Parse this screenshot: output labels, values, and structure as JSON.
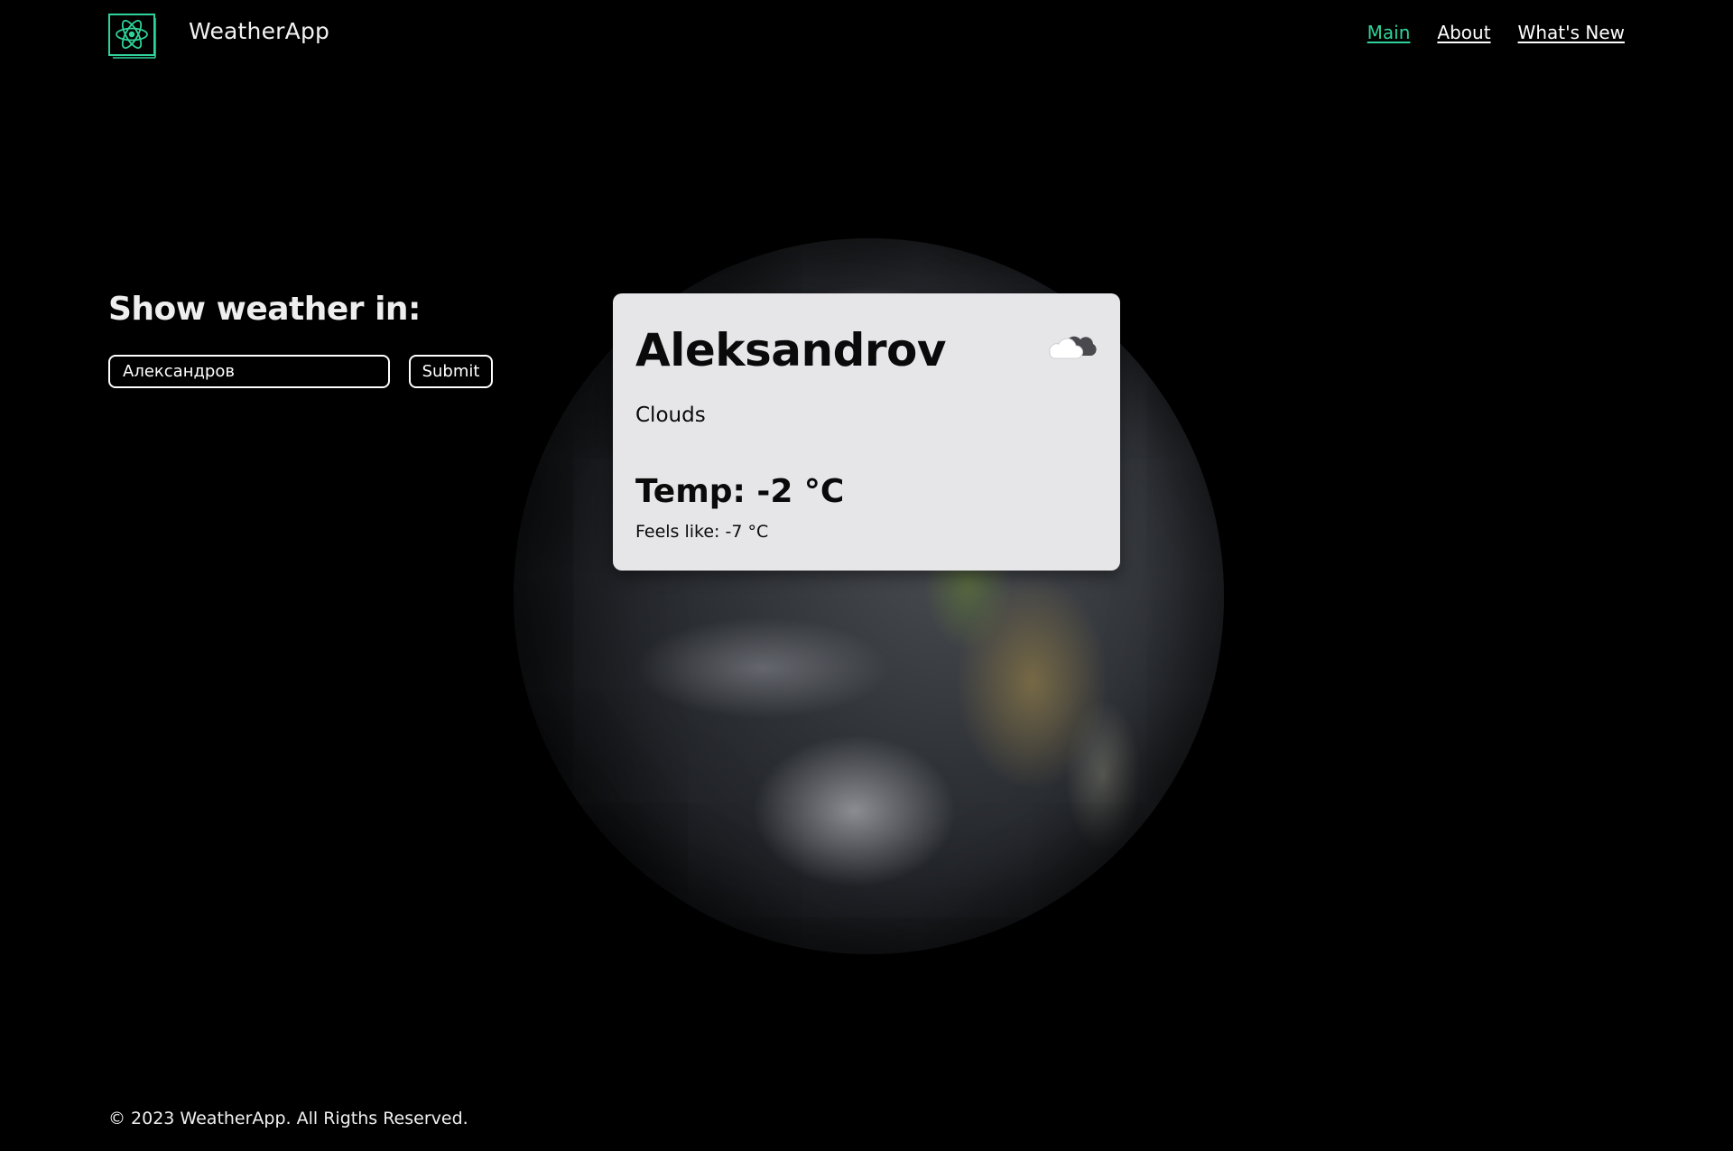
{
  "app": {
    "brand_name": "WeatherApp",
    "accent_color": "#2fd39a",
    "logo_icon": "atom-icon"
  },
  "nav": {
    "items": [
      {
        "label": "Main",
        "active": true
      },
      {
        "label": "About",
        "active": false
      },
      {
        "label": "What's New",
        "active": false
      }
    ]
  },
  "search": {
    "title": "Show weather in:",
    "value": "Александров",
    "submit_label": "Submit"
  },
  "weather": {
    "city": "Aleksandrov",
    "condition": "Clouds",
    "condition_icon": "cloud-icon",
    "temp": "Temp: -2 °C",
    "feels_like": "Feels like: -7 °C"
  },
  "footer": {
    "text": "© 2023 WeatherApp. All Rigths Reserved."
  }
}
